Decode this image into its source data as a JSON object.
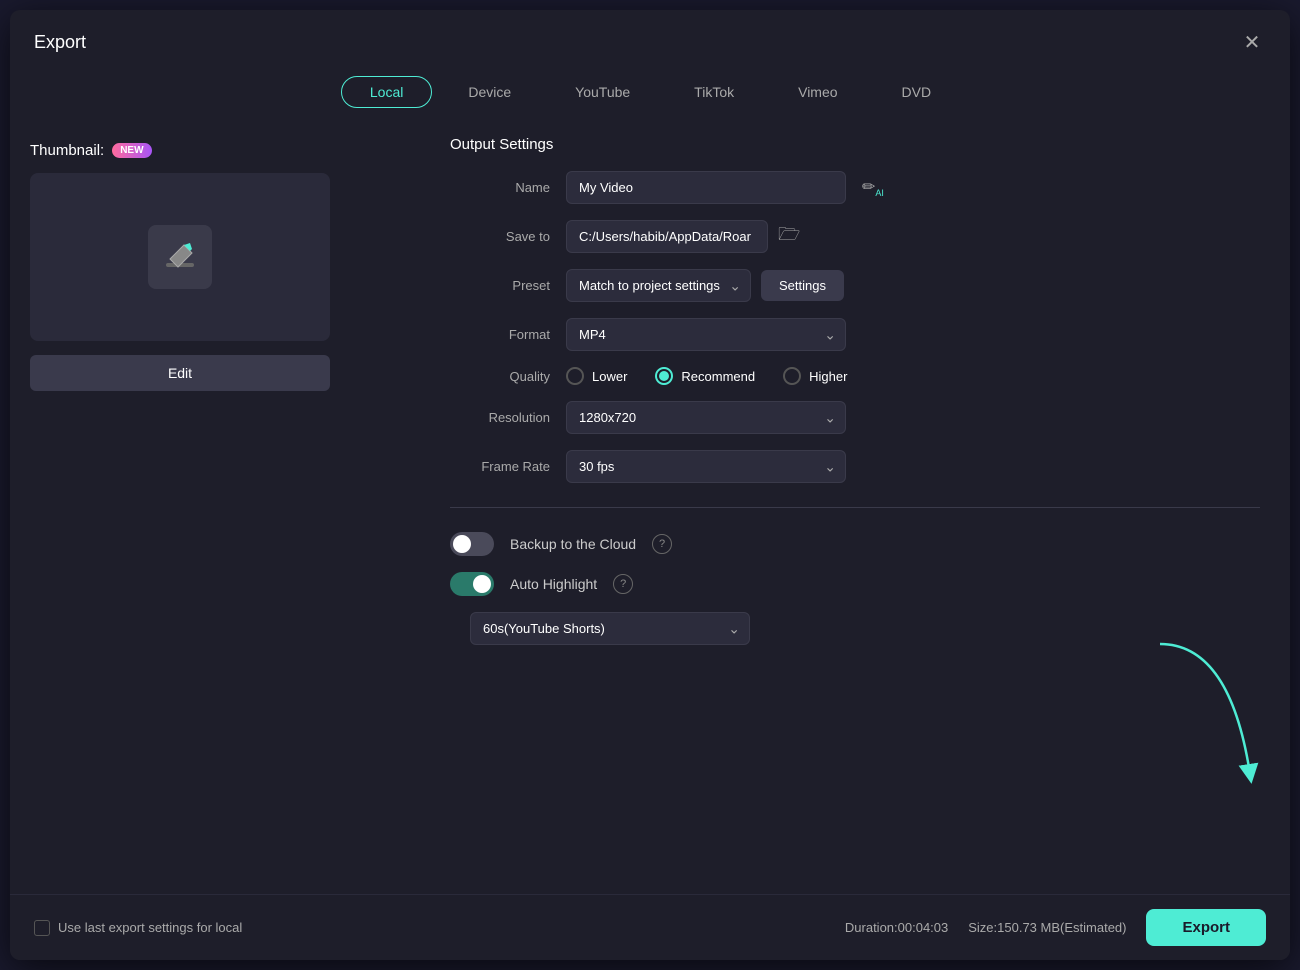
{
  "dialog": {
    "title": "Export",
    "close_label": "✕"
  },
  "tabs": [
    {
      "id": "local",
      "label": "Local",
      "active": true
    },
    {
      "id": "device",
      "label": "Device",
      "active": false
    },
    {
      "id": "youtube",
      "label": "YouTube",
      "active": false
    },
    {
      "id": "tiktok",
      "label": "TikTok",
      "active": false
    },
    {
      "id": "vimeo",
      "label": "Vimeo",
      "active": false
    },
    {
      "id": "dvd",
      "label": "DVD",
      "active": false
    }
  ],
  "left": {
    "thumbnail_label": "Thumbnail:",
    "new_badge": "NEW",
    "edit_btn": "Edit"
  },
  "right": {
    "section_title": "Output Settings",
    "name_label": "Name",
    "name_value": "My Video",
    "save_to_label": "Save to",
    "save_to_value": "C:/Users/habib/AppData/Roar",
    "preset_label": "Preset",
    "preset_value": "Match to project settings",
    "settings_btn": "Settings",
    "format_label": "Format",
    "format_value": "MP4",
    "quality_label": "Quality",
    "quality_options": [
      {
        "id": "lower",
        "label": "Lower",
        "selected": false
      },
      {
        "id": "recommend",
        "label": "Recommend",
        "selected": true
      },
      {
        "id": "higher",
        "label": "Higher",
        "selected": false
      }
    ],
    "resolution_label": "Resolution",
    "resolution_value": "1280x720",
    "frame_rate_label": "Frame Rate",
    "frame_rate_value": "30 fps",
    "backup_label": "Backup to the Cloud",
    "backup_on": false,
    "auto_highlight_label": "Auto Highlight",
    "auto_highlight_on": true,
    "highlight_duration": "60s(YouTube Shorts)"
  },
  "footer": {
    "checkbox_label": "Use last export settings for local",
    "duration_label": "Duration:00:04:03",
    "size_label": "Size:150.73 MB(Estimated)",
    "export_btn": "Export"
  },
  "icons": {
    "ai_icon": "✏",
    "folder_icon": "🗁",
    "help_icon": "?"
  }
}
